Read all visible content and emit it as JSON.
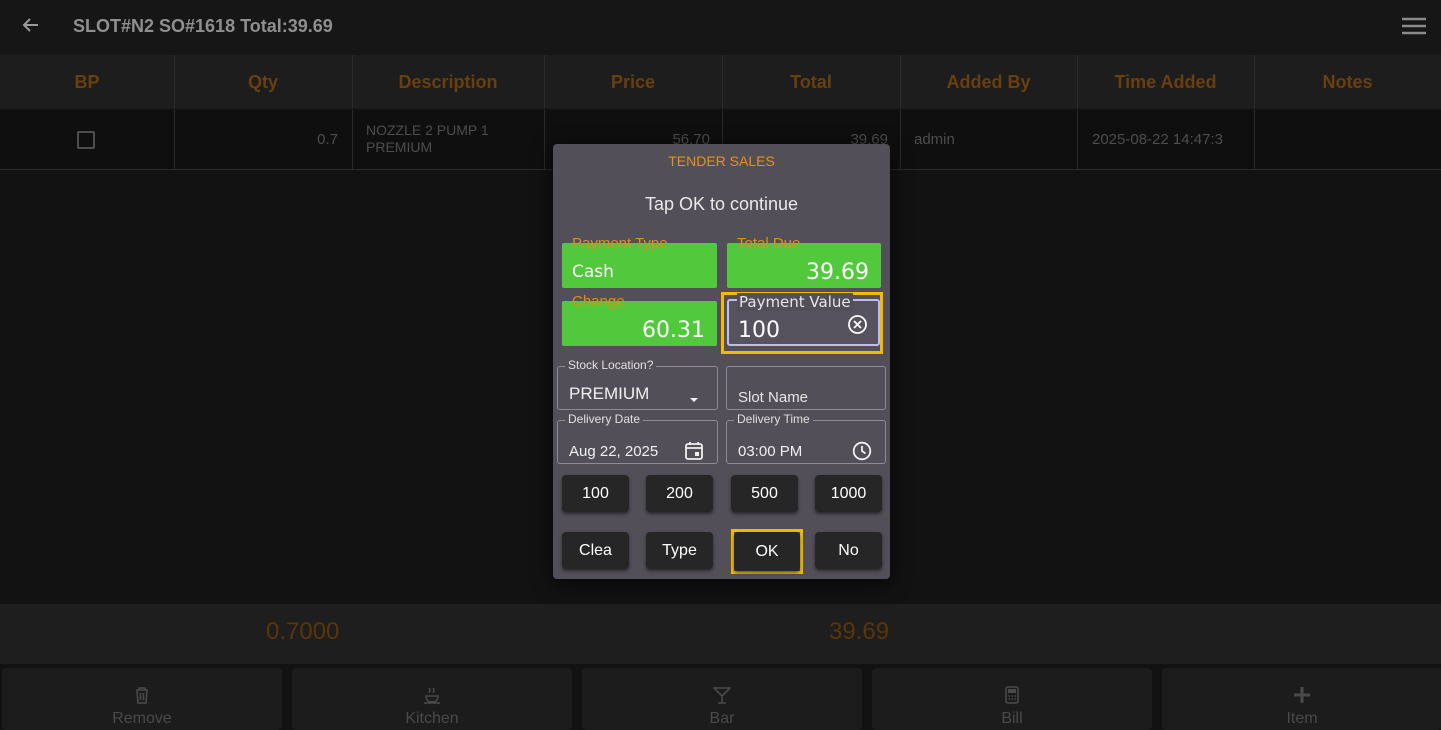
{
  "topbar": {
    "title": "SLOT#N2 SO#1618 Total:39.69"
  },
  "table": {
    "headers": [
      "BP",
      "Qty",
      "Description",
      "Price",
      "Total",
      "Added By",
      "Time Added",
      "Notes"
    ],
    "row": {
      "qty": "0.7",
      "description_line1": "NOZZLE 2 PUMP 1",
      "description_line2": "PREMIUM",
      "price": "56.70",
      "total": "39.69",
      "added_by": "admin",
      "time_added": "2025-08-22 14:47:3",
      "notes": ""
    }
  },
  "footer": {
    "qty_total": "0.7000",
    "amount_total": "39.69"
  },
  "bottom_nav": [
    {
      "label": "Remove",
      "icon": "trash-icon"
    },
    {
      "label": "Kitchen",
      "icon": "kitchen-icon"
    },
    {
      "label": "Bar",
      "icon": "cocktail-icon"
    },
    {
      "label": "Bill",
      "icon": "calculator-icon"
    },
    {
      "label": "Item",
      "icon": "plus-icon"
    }
  ],
  "dialog": {
    "title": "TENDER SALES",
    "message": "Tap OK to continue",
    "payment_type": {
      "label": "Payment Type",
      "value": "Cash"
    },
    "total_due": {
      "label": "Total Due",
      "value": "39.69"
    },
    "change": {
      "label": "Change",
      "value": "60.31"
    },
    "payment_value": {
      "label": "Payment Value",
      "value": "100"
    },
    "stock_location": {
      "label": "Stock Location?",
      "value": "PREMIUM"
    },
    "slot_name": {
      "placeholder": "Slot Name"
    },
    "delivery_date": {
      "label": "Delivery Date",
      "value": "Aug 22, 2025"
    },
    "delivery_time": {
      "label": "Delivery Time",
      "value": "03:00 PM"
    },
    "quick_amounts": [
      "100",
      "200",
      "500",
      "1000"
    ],
    "actions": {
      "clear": "Clea",
      "type": "Type",
      "ok": "OK",
      "no": "No"
    }
  },
  "colors": {
    "accent_orange": "#e8920d",
    "green": "#52c83c",
    "highlight": "#f2ba00",
    "dialog_bg": "#534f59"
  }
}
